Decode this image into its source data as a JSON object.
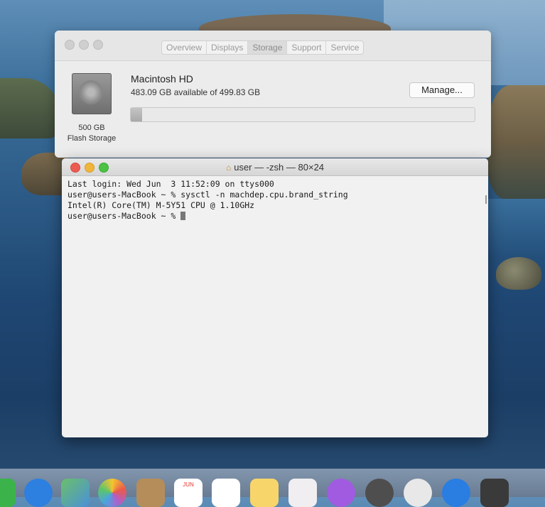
{
  "about_window": {
    "tabs": [
      {
        "label": "Overview"
      },
      {
        "label": "Displays"
      },
      {
        "label": "Storage"
      },
      {
        "label": "Support"
      },
      {
        "label": "Service"
      }
    ],
    "active_tab": "Storage",
    "drive_name": "Macintosh HD",
    "available_text": "483.09 GB available of 499.83 GB",
    "used_fraction": 0.033,
    "manage_label": "Manage...",
    "disk_size": "500 GB",
    "disk_type": "Flash Storage"
  },
  "terminal": {
    "title": "user — -zsh — 80×24",
    "lines": [
      "Last login: Wed Jun  3 11:52:09 on ttys000",
      "user@users-MacBook ~ % sysctl -n machdep.cpu.brand_string",
      "Intel(R) Core(TM) M-5Y51 CPU @ 1.10GHz",
      "user@users-MacBook ~ % "
    ]
  },
  "dock": {
    "calendar_month": "JUN",
    "icons": [
      "messages-icon",
      "safari-icon",
      "maps-icon",
      "photos-icon",
      "contacts-icon",
      "calendar-icon",
      "reminders-icon",
      "notes-icon",
      "music-icon",
      "podcasts-icon",
      "tv-icon",
      "appstore-icon",
      "siri-icon",
      "other-icon"
    ]
  },
  "colors": {
    "close": "#ec5b52",
    "minimize": "#f0b53b",
    "zoom": "#4cc244"
  }
}
